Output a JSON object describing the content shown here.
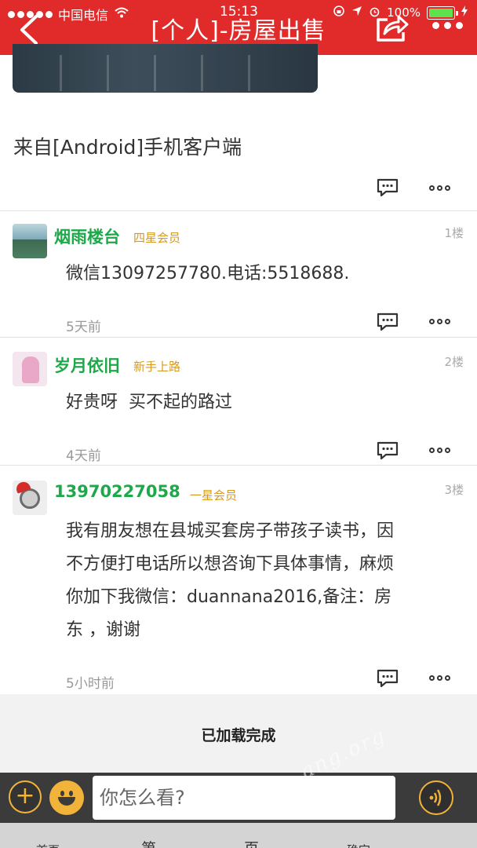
{
  "status_bar": {
    "carrier": "中国电信",
    "time": "15:13",
    "battery": "100%"
  },
  "header": {
    "title": "[个人]-房屋出售"
  },
  "post": {
    "source": "来自[Android]手机客户端"
  },
  "comments": [
    {
      "user": "烟雨楼台",
      "rank": "四星会员",
      "floor": "1楼",
      "lines": [
        "微信13097257780.电话:5518688."
      ],
      "time": "5天前"
    },
    {
      "user": "岁月依旧",
      "rank": "新手上路",
      "floor": "2楼",
      "lines": [
        "好贵呀  买不起的路过"
      ],
      "time": "4天前"
    },
    {
      "user": "13970227058",
      "rank": "一星会员",
      "floor": "3楼",
      "lines": [
        "我有朋友想在县城买套房子带孩子读书，因",
        "不方便打电话所以想咨询下具体事情，麻烦",
        "你加下我微信：duannana2016,备注：房",
        "东 ，谢谢"
      ],
      "time": "5小时前"
    }
  ],
  "loaded_text": "已加载完成",
  "input": {
    "placeholder": "你怎么看?"
  },
  "pager": {
    "prev": "首页",
    "page_prefix": "第",
    "page_suffix": "页",
    "confirm": "确定"
  },
  "watermark": "ang.org",
  "icons": {
    "back": "chevron-left-icon",
    "share": "share-icon",
    "more": "more-dots-icon",
    "comment": "comment-icon",
    "plus": "plus-icon",
    "emoji": "emoji-icon",
    "voice": "voice-icon"
  },
  "colors": {
    "header": "#e12b2b",
    "username": "#1fa84a",
    "rank": "#d69a22",
    "accent": "#f2b33a"
  }
}
